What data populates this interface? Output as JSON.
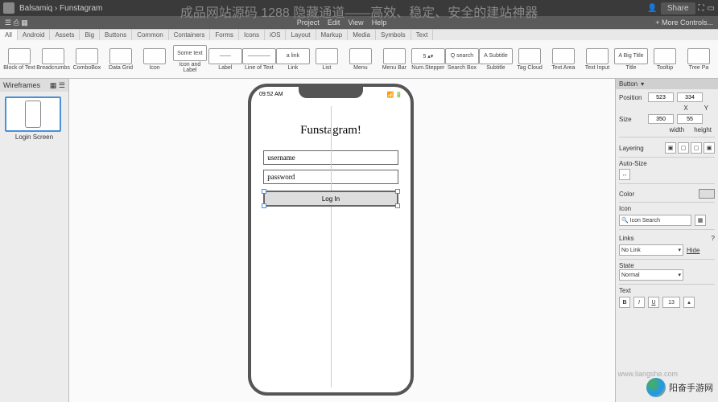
{
  "overlay": "成品网站源码 1288 隐藏通道——高效、稳定、安全的建站神器",
  "topbar": {
    "breadcrumb1": "Balsamiq",
    "breadcrumb2": "Funstagram",
    "share": "Share"
  },
  "menubar": {
    "items": [
      "Project",
      "Edit",
      "View",
      "Help"
    ],
    "more": "+ More Controls..."
  },
  "ribbon_tabs": [
    "All",
    "Android",
    "Assets",
    "Big",
    "Buttons",
    "Common",
    "Containers",
    "Forms",
    "Icons",
    "iOS",
    "Layout",
    "Markup",
    "Media",
    "Symbols",
    "Text"
  ],
  "ribbon_items": [
    {
      "label": "Block of Text"
    },
    {
      "label": "Breadcrumbs"
    },
    {
      "label": "ComboBox"
    },
    {
      "label": "Data Grid"
    },
    {
      "label": "Icon"
    },
    {
      "label": "Icon and Label",
      "text": "Some text"
    },
    {
      "label": "Label",
      "text": "——"
    },
    {
      "label": "Line of Text",
      "text": "————"
    },
    {
      "label": "Link",
      "text": "a link"
    },
    {
      "label": "List"
    },
    {
      "label": "Menu"
    },
    {
      "label": "Menu Bar"
    },
    {
      "label": "Num.Stepper",
      "text": "5 ▴▾"
    },
    {
      "label": "Search Box",
      "text": "Q search"
    },
    {
      "label": "Subtitle",
      "text": "A Subtitle"
    },
    {
      "label": "Tag Cloud"
    },
    {
      "label": "Text Area"
    },
    {
      "label": "Text Input"
    },
    {
      "label": "Title",
      "text": "A Big Title"
    },
    {
      "label": "Tooltip"
    },
    {
      "label": "Tree Pa"
    }
  ],
  "left": {
    "header": "Wireframes",
    "thumb_label": "Login Screen"
  },
  "canvas": {
    "time": "09:52 AM",
    "signal": "📶 🔋",
    "app_title": "Funstagram!",
    "username_ph": "username",
    "password_ph": "password",
    "login": "Log In"
  },
  "right": {
    "header": "Button",
    "position_label": "Position",
    "pos_x": "523",
    "pos_y": "334",
    "x_label": "X",
    "y_label": "Y",
    "size_label": "Size",
    "size_w": "350",
    "size_h": "55",
    "w_label": "width",
    "h_label": "height",
    "layering": "Layering",
    "autosize": "Auto-Size",
    "color": "Color",
    "icon": "Icon",
    "icon_search": "Icon Search",
    "links": "Links",
    "no_link": "No Link",
    "hide": "Hide",
    "state": "State",
    "state_val": "Normal",
    "text": "Text",
    "font_size": "13"
  },
  "watermark1": "www.liangshe.com",
  "watermark2": "阳奋手游网"
}
